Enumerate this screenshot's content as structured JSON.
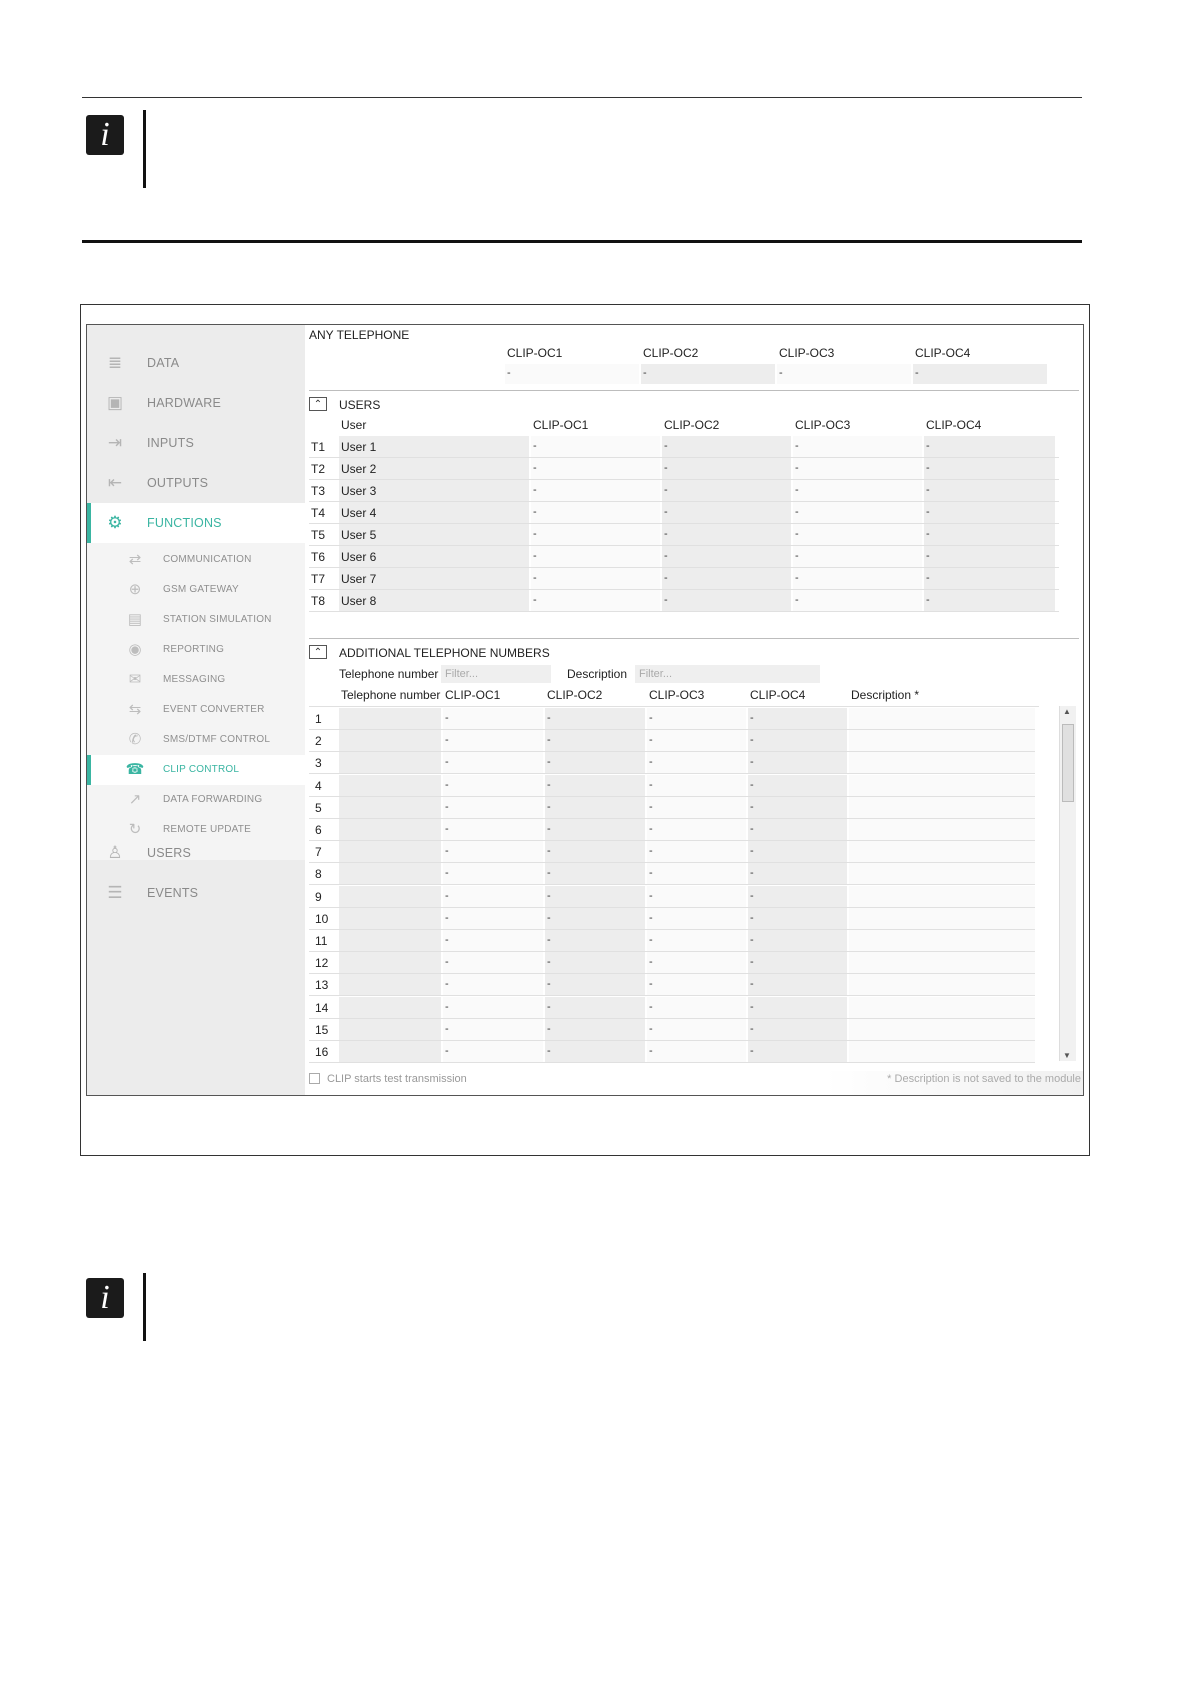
{
  "app": {
    "sidebar": {
      "main_items": [
        {
          "label": "DATA",
          "icon": "database-icon",
          "glyph": "≣"
        },
        {
          "label": "HARDWARE",
          "icon": "chip-icon",
          "glyph": "▣"
        },
        {
          "label": "INPUTS",
          "icon": "input-icon",
          "glyph": "⇥"
        },
        {
          "label": "OUTPUTS",
          "icon": "output-icon",
          "glyph": "⇤"
        },
        {
          "label": "FUNCTIONS",
          "icon": "gear-icon",
          "glyph": "⚙"
        },
        {
          "label": "USERS",
          "icon": "user-icon",
          "glyph": "♙"
        },
        {
          "label": "EVENTS",
          "icon": "document-icon",
          "glyph": "☰"
        }
      ],
      "active_main": "FUNCTIONS",
      "sub_items": [
        {
          "label": "COMMUNICATION",
          "icon": "communication-icon",
          "glyph": "⇄"
        },
        {
          "label": "GSM GATEWAY",
          "icon": "gsm-gateway-icon",
          "glyph": "⊕"
        },
        {
          "label": "STATION SIMULATION",
          "icon": "station-icon",
          "glyph": "▤"
        },
        {
          "label": "REPORTING",
          "icon": "eye-icon",
          "glyph": "◉"
        },
        {
          "label": "MESSAGING",
          "icon": "message-icon",
          "glyph": "✉"
        },
        {
          "label": "EVENT CONVERTER",
          "icon": "converter-icon",
          "glyph": "⇆"
        },
        {
          "label": "SMS/DTMF CONTROL",
          "icon": "sms-icon",
          "glyph": "✆"
        },
        {
          "label": "CLIP CONTROL",
          "icon": "phone-clip-icon",
          "glyph": "☎"
        },
        {
          "label": "DATA FORWARDING",
          "icon": "forward-icon",
          "glyph": "↗"
        },
        {
          "label": "REMOTE UPDATE",
          "icon": "refresh-icon",
          "glyph": "↻"
        }
      ],
      "active_sub": "CLIP CONTROL"
    },
    "any_telephone": {
      "title": "ANY TELEPHONE",
      "columns": [
        "CLIP-OC1",
        "CLIP-OC2",
        "CLIP-OC3",
        "CLIP-OC4"
      ],
      "values": [
        "-",
        "-",
        "-",
        "-"
      ]
    },
    "users": {
      "collapse_glyph": "⌃",
      "title": "USERS",
      "columns": [
        "User",
        "CLIP-OC1",
        "CLIP-OC2",
        "CLIP-OC3",
        "CLIP-OC4"
      ],
      "rows": [
        {
          "id": "T1",
          "user": "User 1",
          "values": [
            "-",
            "-",
            "-",
            "-"
          ]
        },
        {
          "id": "T2",
          "user": "User 2",
          "values": [
            "-",
            "-",
            "-",
            "-"
          ]
        },
        {
          "id": "T3",
          "user": "User 3",
          "values": [
            "-",
            "-",
            "-",
            "-"
          ]
        },
        {
          "id": "T4",
          "user": "User 4",
          "values": [
            "-",
            "-",
            "-",
            "-"
          ]
        },
        {
          "id": "T5",
          "user": "User 5",
          "values": [
            "-",
            "-",
            "-",
            "-"
          ]
        },
        {
          "id": "T6",
          "user": "User 6",
          "values": [
            "-",
            "-",
            "-",
            "-"
          ]
        },
        {
          "id": "T7",
          "user": "User 7",
          "values": [
            "-",
            "-",
            "-",
            "-"
          ]
        },
        {
          "id": "T8",
          "user": "User 8",
          "values": [
            "-",
            "-",
            "-",
            "-"
          ]
        }
      ]
    },
    "additional": {
      "collapse_glyph": "⌃",
      "title": "ADDITIONAL TELEPHONE NUMBERS",
      "filter_phone_label": "Telephone number",
      "filter_phone_placeholder": "Filter...",
      "filter_desc_label": "Description",
      "filter_desc_placeholder": "Filter...",
      "columns": [
        "Telephone number",
        "CLIP-OC1",
        "CLIP-OC2",
        "CLIP-OC3",
        "CLIP-OC4",
        "Description *"
      ],
      "rows": [
        {
          "n": "1"
        },
        {
          "n": "2"
        },
        {
          "n": "3"
        },
        {
          "n": "4"
        },
        {
          "n": "5"
        },
        {
          "n": "6"
        },
        {
          "n": "7"
        },
        {
          "n": "8"
        },
        {
          "n": "9"
        },
        {
          "n": "10"
        },
        {
          "n": "11"
        },
        {
          "n": "12"
        },
        {
          "n": "13"
        },
        {
          "n": "14"
        },
        {
          "n": "15"
        },
        {
          "n": "16"
        }
      ],
      "cell_value": "-"
    },
    "footer": {
      "checkbox_label": "CLIP starts test transmission",
      "note": "* Description is not saved to the module"
    },
    "accent_color": "#3ab5a2"
  }
}
